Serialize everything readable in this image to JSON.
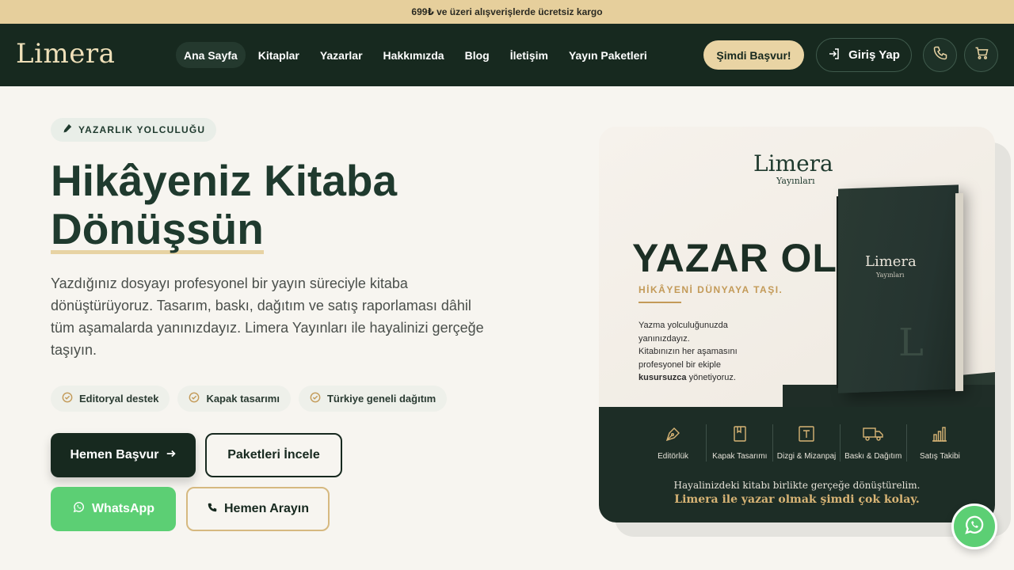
{
  "announcement": {
    "text": "699₺ ve üzeri alışverişlerde ücretsiz kargo"
  },
  "brand": {
    "name": "Limera"
  },
  "nav": {
    "items": [
      {
        "label": "Ana Sayfa",
        "active": true
      },
      {
        "label": "Kitaplar"
      },
      {
        "label": "Yazarlar"
      },
      {
        "label": "Hakkımızda"
      },
      {
        "label": "Blog"
      },
      {
        "label": "İletişim"
      },
      {
        "label": "Yayın Paketleri"
      }
    ],
    "cta_label": "Şimdi Başvur!",
    "login_label": "Giriş Yap"
  },
  "hero": {
    "badge": "YAZARLIK YOLCULUĞU",
    "title_line1": "Hikâyeniz Kitaba",
    "title_line2": "Dönüşsün",
    "description": "Yazdığınız dosyayı profesyonel bir yayın süreciyle kitaba dönüştürüyoruz. Tasarım, baskı, dağıtım ve satış raporlaması dâhil tüm aşamalarda yanınızdayız. Limera Yayınları ile hayalinizi gerçeğe taşıyın.",
    "features": [
      {
        "label": "Editoryal destek"
      },
      {
        "label": "Kapak tasarımı"
      },
      {
        "label": "Türkiye geneli dağıtım"
      }
    ],
    "buttons": {
      "apply": "Hemen Başvur",
      "packages": "Paketleri İncele",
      "whatsapp": "WhatsApp",
      "call": "Hemen Arayın"
    }
  },
  "promo": {
    "logo": "Limera",
    "logo_sub": "Yayınları",
    "title": "YAZAR OL",
    "subtitle": "HİKÂYENİ DÜNYAYA TAŞI.",
    "body_1": "Yazma yolculuğunuzda yanınızdayız.",
    "body_2": "Kitabınızın her aşamasını profesyonel bir ekiple",
    "body_bold": "kusursuzca",
    "body_3": "yönetiyoruz.",
    "book_logo": "Limera",
    "book_logo_sub": "Yayınları",
    "book_mark": "L",
    "services": [
      {
        "label": "Editörlük",
        "icon": "pen-nib-icon"
      },
      {
        "label": "Kapak Tasarımı",
        "icon": "book-icon"
      },
      {
        "label": "Dizgi & Mizanpaj",
        "icon": "text-box-icon"
      },
      {
        "label": "Baskı & Dağıtım",
        "icon": "truck-icon"
      },
      {
        "label": "Satış Takibi",
        "icon": "bar-chart-icon"
      }
    ],
    "footer_line1": "Hayalinizdeki kitabı birlikte gerçeğe dönüştürelim.",
    "footer_line2": "Limera ile yazar olmak şimdi çok kolay."
  },
  "colors": {
    "primary": "#17291f",
    "accent": "#e9d4a4",
    "gold": "#c39a58",
    "whatsapp": "#5ccf74",
    "background": "#f7f5f0"
  }
}
